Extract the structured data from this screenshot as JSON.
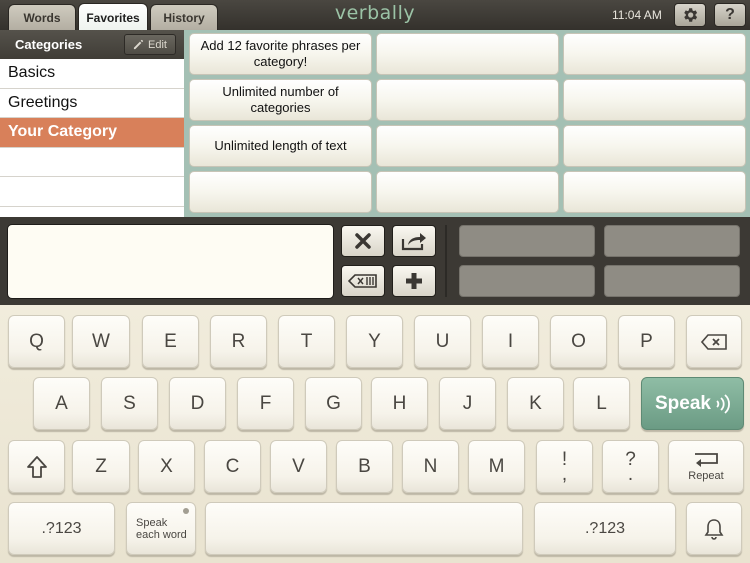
{
  "tabs": [
    {
      "label": "Words",
      "active": false
    },
    {
      "label": "Favorites",
      "active": true
    },
    {
      "label": "History",
      "active": false
    }
  ],
  "brand": "verbally",
  "clock": "11:04 AM",
  "icons": {
    "settings": "gear-icon",
    "help": "question-icon",
    "edit": "pencil-icon"
  },
  "help_label": "?",
  "categories": {
    "title": "Categories",
    "edit_label": "Edit",
    "items": [
      "Basics",
      "Greetings",
      "Your Category",
      "",
      ""
    ],
    "selected": "Your Category"
  },
  "phrases": [
    [
      "Add 12 favorite phrases per category!",
      "",
      ""
    ],
    [
      "Unlimited number of categories",
      "",
      ""
    ],
    [
      "Unlimited length of text",
      "",
      ""
    ],
    [
      "",
      "",
      ""
    ]
  ],
  "text_input": {
    "value": ""
  },
  "keyboard": {
    "row1": [
      "Q",
      "W",
      "E",
      "R",
      "T",
      "Y",
      "U",
      "I",
      "O",
      "P"
    ],
    "row2": [
      "A",
      "S",
      "D",
      "F",
      "G",
      "H",
      "J",
      "K",
      "L"
    ],
    "row3": [
      "Z",
      "X",
      "C",
      "V",
      "B",
      "N",
      "M"
    ],
    "speak_label": "Speak",
    "repeat_label": "Repeat",
    "numbers_label": ".?123",
    "speak_each_word_label": "Speak each word",
    "punct1": [
      "!",
      ","
    ],
    "punct2": [
      "?",
      "."
    ]
  },
  "colors": {
    "accent": "#d8805a",
    "speak": "#7aab92",
    "grid_bg": "#a4c0b4"
  }
}
